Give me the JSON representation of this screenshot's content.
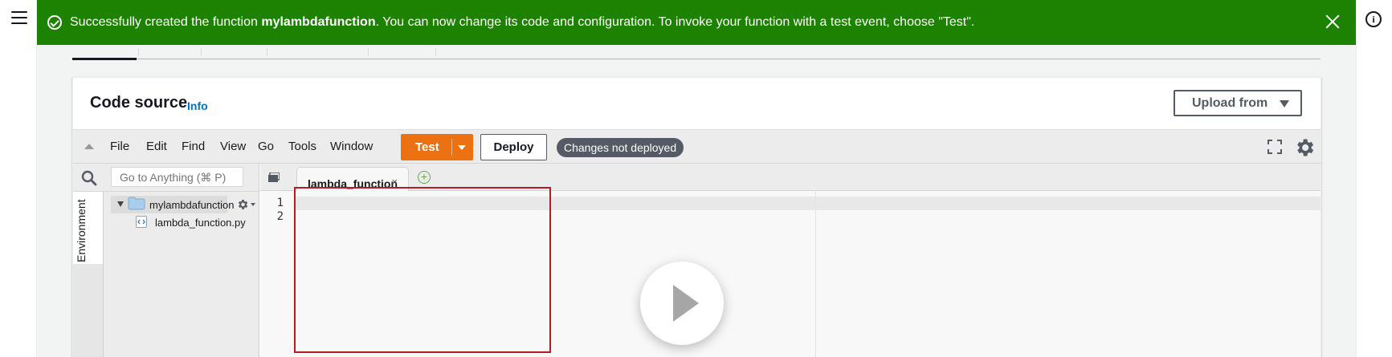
{
  "notification": {
    "prefix": "Successfully created the function ",
    "function_name": "mylambdafunction",
    "suffix": ". You can now change its code and configuration. To invoke your function with a test event, choose \"Test\"."
  },
  "panel": {
    "title": "Code source",
    "info_link": "Info",
    "upload_button": "Upload from"
  },
  "toolbar": {
    "menu": [
      "File",
      "Edit",
      "Find",
      "View",
      "Go",
      "Tools",
      "Window"
    ],
    "test_button": "Test",
    "deploy_button": "Deploy",
    "status_badge": "Changes not deployed"
  },
  "sidebar": {
    "search_placeholder": "Go to Anything (⌘ P)",
    "environment_tab": "Environment",
    "folder_name": "mylambdafunction",
    "file_name": "lambda_function.py"
  },
  "editor": {
    "tab_name": "lambda_function",
    "tab_close": "×",
    "add_tab": "+",
    "line_numbers": [
      "1",
      "2"
    ]
  },
  "colors": {
    "success": "#1d8102",
    "primary": "#ec7211",
    "link": "#0073bb",
    "badge": "#545b64",
    "highlight_border": "#b01f24"
  },
  "icons": [
    "hamburger-icon",
    "info-icon",
    "check-circle-icon",
    "close-icon",
    "caret-down-icon",
    "collapse-icon",
    "expand-icon",
    "gear-icon",
    "search-icon",
    "folder-icon",
    "python-file-icon",
    "tabs-menu-icon",
    "add-tab-icon",
    "play-icon"
  ]
}
